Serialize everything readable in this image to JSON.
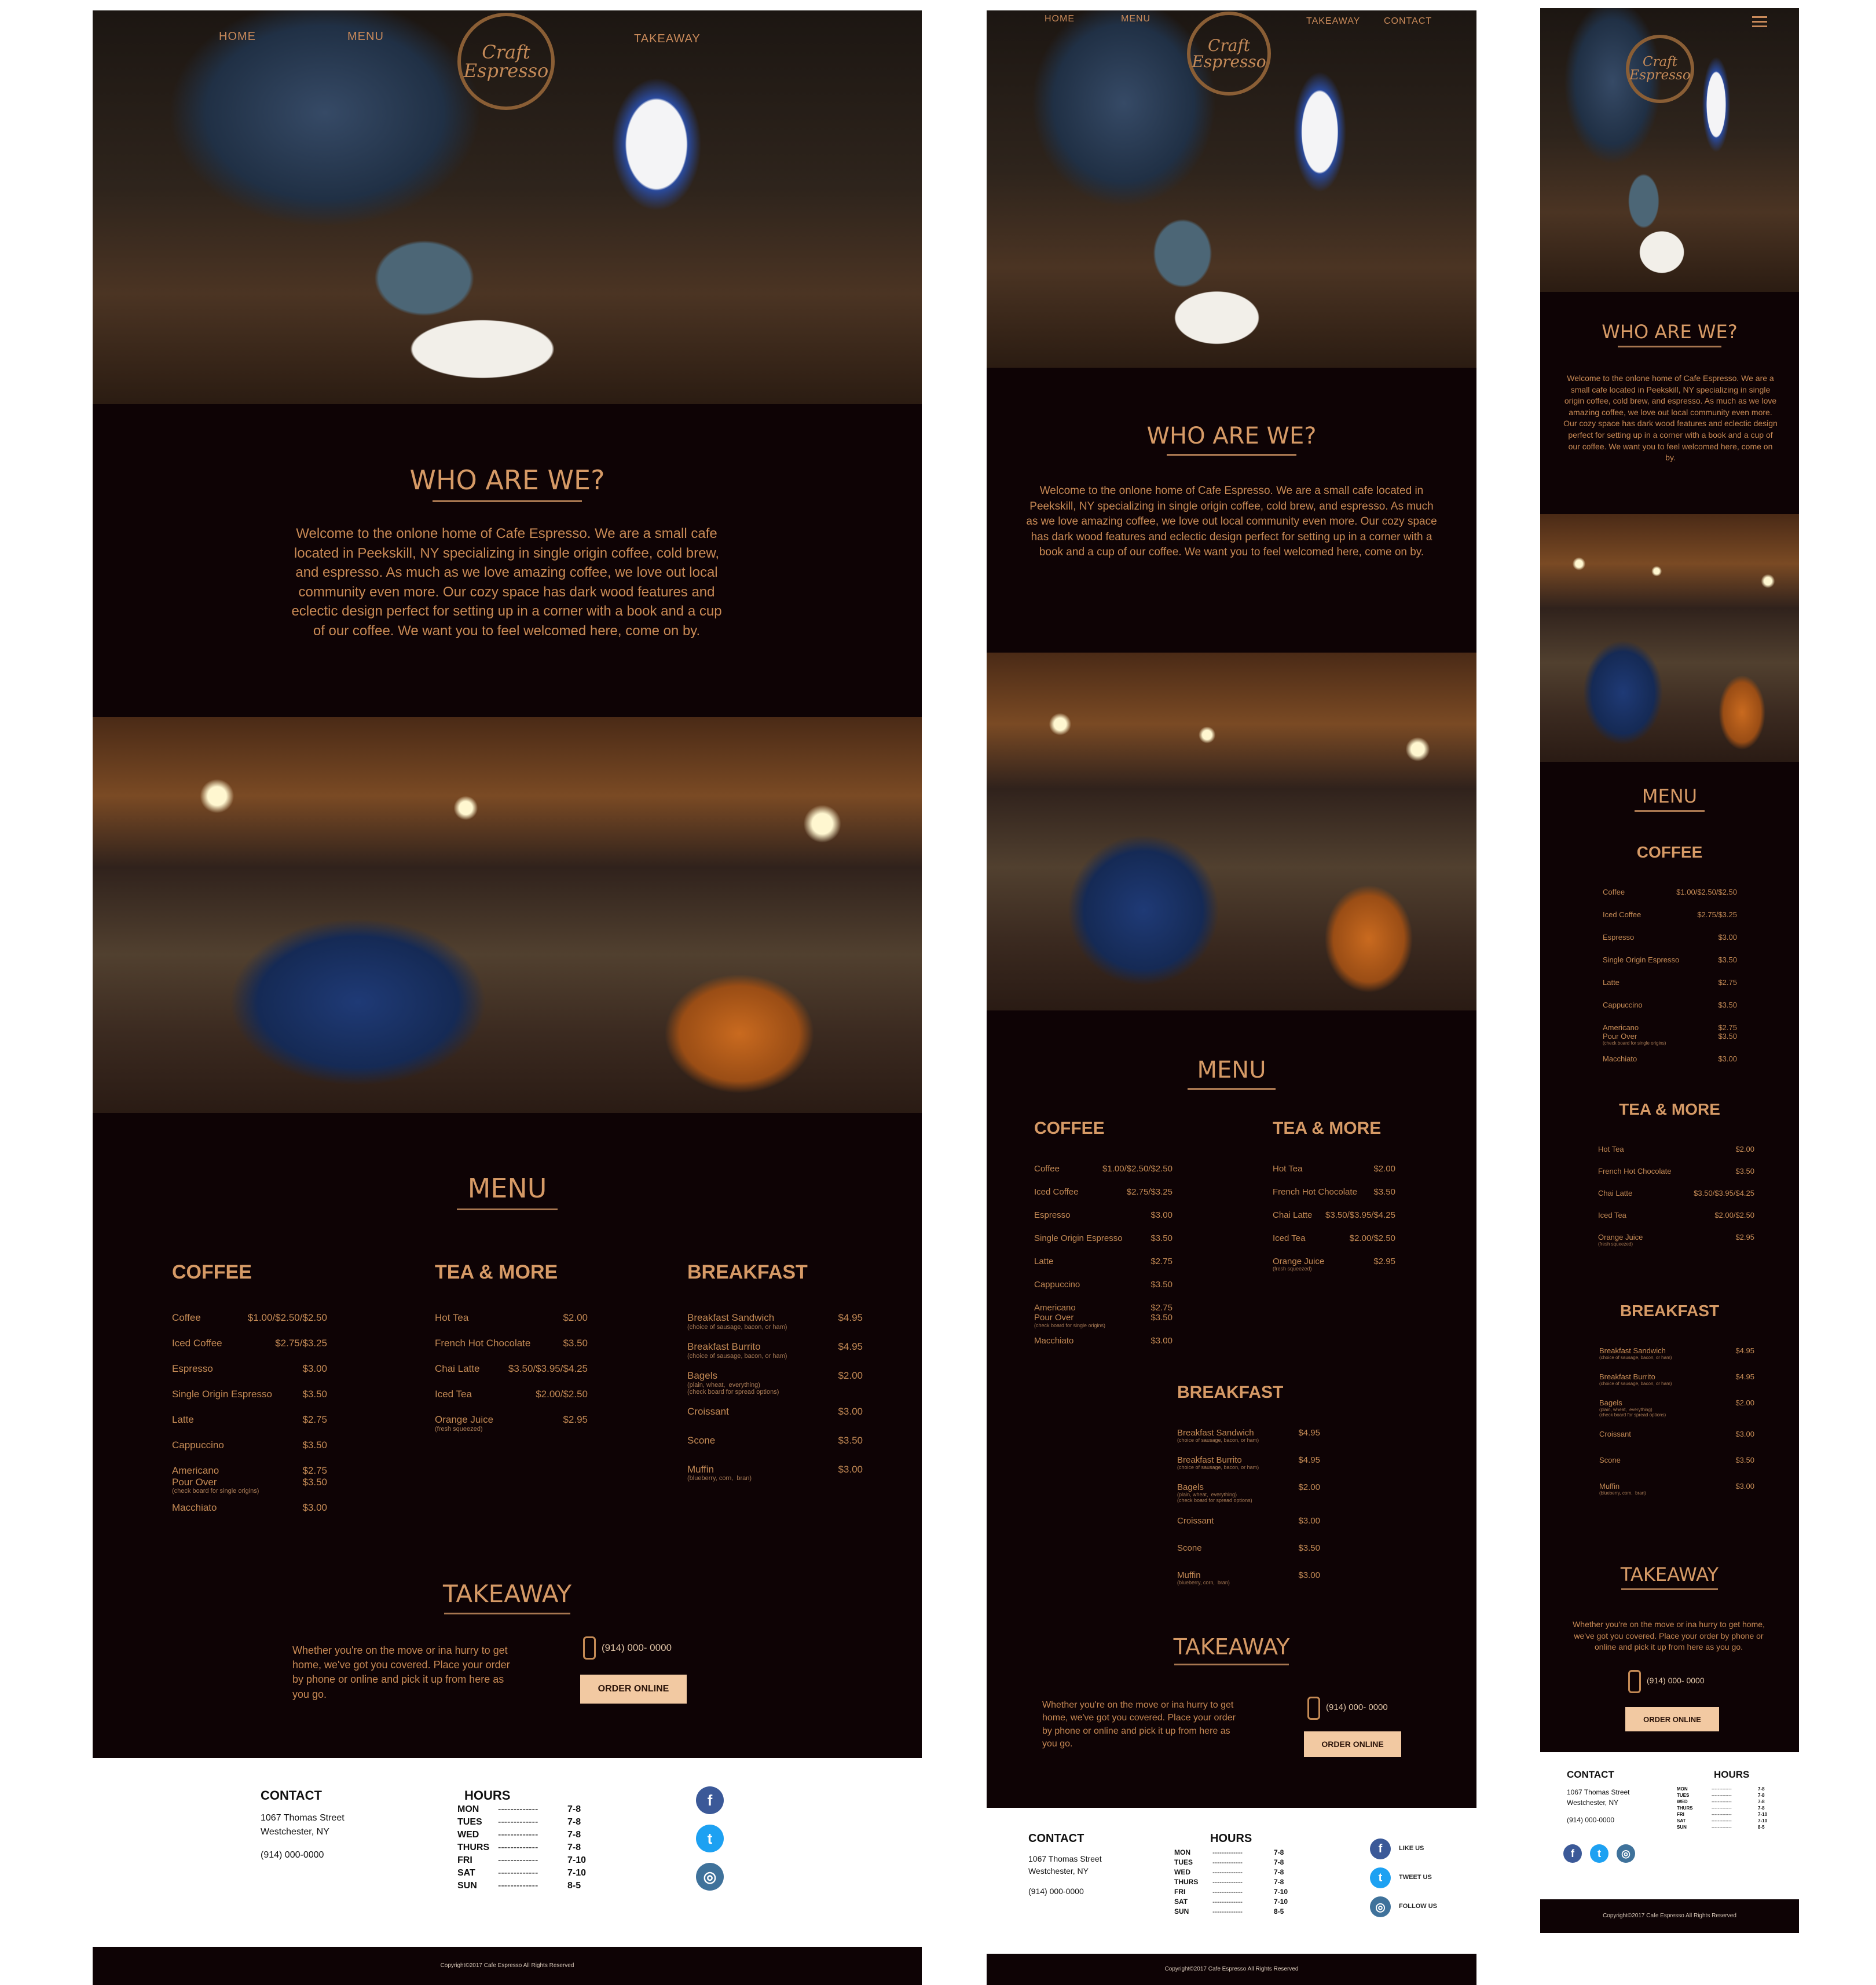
{
  "nav": {
    "home": "HOME",
    "menu": "MENU",
    "takeaway": "TAKEAWAY",
    "contact": "CONTACT"
  },
  "logo": {
    "line1": "Craft",
    "line2": "Espresso"
  },
  "about": {
    "title": "WHO ARE WE?",
    "text": "Welcome to the onlone home of Cafe Espresso. We are a small cafe located in Peekskill, NY specializing in single origin coffee, cold brew, and espresso. As much as we love amazing coffee, we love out local community even more. Our cozy space has dark wood features and eclectic design perfect for setting up in a corner with a book and a cup of our coffee. We want you to feel welcomed here, come on by."
  },
  "menu": {
    "title": "MENU",
    "coffee": {
      "heading": "COFFEE",
      "items": [
        {
          "name": "Coffee",
          "price": "$1.00/$2.50/$2.50",
          "sub": ""
        },
        {
          "name": "Iced Coffee",
          "price": "$2.75/$3.25",
          "sub": ""
        },
        {
          "name": "Espresso",
          "price": "$3.00",
          "sub": ""
        },
        {
          "name": "Single Origin Espresso",
          "price": "$3.50",
          "sub": ""
        },
        {
          "name": "Latte",
          "price": "$2.75",
          "sub": ""
        },
        {
          "name": "Cappuccino",
          "price": "$3.50",
          "sub": ""
        },
        {
          "name": "Americano\nPour Over",
          "price": "$2.75\n$3.50",
          "sub": "(check board for single origins)"
        },
        {
          "name": "Macchiato",
          "price": "$3.00",
          "sub": ""
        }
      ]
    },
    "tea": {
      "heading": "TEA & MORE",
      "items": [
        {
          "name": "Hot Tea",
          "price": "$2.00",
          "sub": ""
        },
        {
          "name": "French Hot Chocolate",
          "price": "$3.50",
          "sub": ""
        },
        {
          "name": "Chai Latte",
          "price": "$3.50/$3.95/$4.25",
          "sub": ""
        },
        {
          "name": "Iced Tea",
          "price": "$2.00/$2.50",
          "sub": ""
        },
        {
          "name": "Orange Juice",
          "price": "$2.95",
          "sub": "(fresh squeezed)"
        }
      ]
    },
    "breakfast": {
      "heading": "BREAKFAST",
      "items": [
        {
          "name": "Breakfast Sandwich",
          "price": "$4.95",
          "sub": "(choice of sausage, bacon, or ham)"
        },
        {
          "name": "Breakfast Burrito",
          "price": "$4.95",
          "sub": "(choice of sausage, bacon, or ham)"
        },
        {
          "name": "Bagels",
          "price": "$2.00",
          "sub": "(plain, wheat,  everything)\n(check board for spread options)"
        },
        {
          "name": "Croissant",
          "price": "$3.00",
          "sub": ""
        },
        {
          "name": "Scone",
          "price": "$3.50",
          "sub": ""
        },
        {
          "name": "Muffin",
          "price": "$3.00",
          "sub": "(blueberry, corn,  bran)"
        }
      ]
    }
  },
  "takeaway": {
    "title": "TAKEAWAY",
    "text": "Whether you're on the move or ina hurry to get home, we've got you covered. Place your order by phone or online and pick it up from here as you go.",
    "phone": "(914) 000- 0000",
    "button": "ORDER ONLINE"
  },
  "contact": {
    "title": "CONTACT",
    "address1": "1067 Thomas Street",
    "address2": "Westchester, NY",
    "phone": "(914) 000-0000"
  },
  "hours": {
    "title": "HOURS",
    "rows": [
      {
        "day": "MON",
        "dots": "-------------",
        "time": "7-8"
      },
      {
        "day": "TUES",
        "dots": "-------------",
        "time": "7-8"
      },
      {
        "day": "WED",
        "dots": "-------------",
        "time": "7-8"
      },
      {
        "day": "THURS",
        "dots": "-------------",
        "time": "7-8"
      },
      {
        "day": "FRI",
        "dots": "-------------",
        "time": "7-10"
      },
      {
        "day": "SAT",
        "dots": "-------------",
        "time": "7-10"
      },
      {
        "day": "SUN",
        "dots": "-------------",
        "time": "8-5"
      }
    ]
  },
  "social": {
    "like": "LIKE US",
    "tweet": "TWEET US",
    "follow": "FOLLOW US"
  },
  "copyright": "Copyright©2017 Cafe Espresso All Rights Reserved"
}
